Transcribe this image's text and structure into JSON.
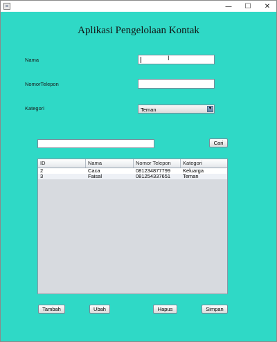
{
  "window": {
    "controls": {
      "minimize": "—",
      "maximize": "☐",
      "close": "✕"
    }
  },
  "page": {
    "title": "Aplikasi Pengelolaan Kontak"
  },
  "form": {
    "nama_label": "Nama",
    "nama_value": "",
    "telepon_label": "NomorTelepon",
    "telepon_value": "",
    "kategori_label": "Kategori",
    "kategori_selected": "Teman"
  },
  "search": {
    "value": "",
    "button_label": "Cari"
  },
  "table": {
    "columns": [
      "ID",
      "Nama",
      "Nomor Telepon",
      "Kategori"
    ],
    "rows": [
      [
        "2",
        "Caca",
        "081234877799",
        "Keluarga"
      ],
      [
        "3",
        "Faisal",
        "081254337651",
        "Teman"
      ]
    ]
  },
  "actions": {
    "tambah_label": "Tambah",
    "ubah_label": "Ubah",
    "hapus_label": "Hapus",
    "simpan_label": "Simpan"
  },
  "colors": {
    "background": "#2fd9c6",
    "table_empty": "#d7dadf"
  },
  "icons": {
    "app": "window-icon",
    "dropdown": "chevron-down-icon"
  }
}
